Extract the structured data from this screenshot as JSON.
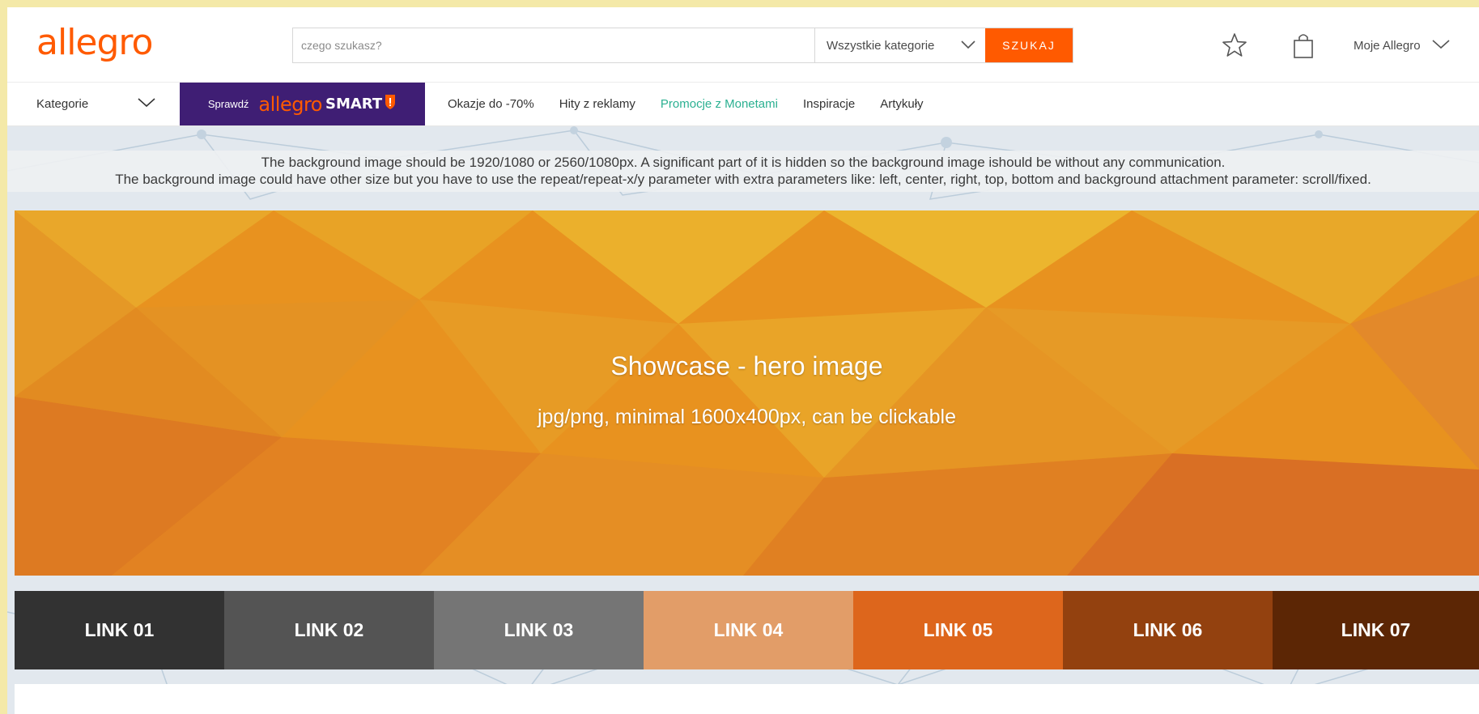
{
  "header": {
    "logo_text": "allegro",
    "search": {
      "placeholder": "czego szukasz?",
      "category_label": "Wszystkie kategorie",
      "button_label": "SZUKAJ"
    },
    "account_label": "Moje Allegro"
  },
  "nav": {
    "categories_label": "Kategorie",
    "smart_prefix": "Sprawdź",
    "smart_logo": "allegro",
    "smart_word": "SMART",
    "links": [
      {
        "label": "Okazje do -70%"
      },
      {
        "label": "Hity z reklamy"
      },
      {
        "label": "Promocje z Monetami"
      },
      {
        "label": "Inspiracje"
      },
      {
        "label": "Artykuły"
      }
    ]
  },
  "notice": {
    "line1": "The background image should be 1920/1080 or 2560/1080px. A significant part of it is hidden so the background image ishould be without any communication.",
    "line2": "The background image could have other size but you have to use the repeat/repeat-x/y parameter with extra parameters like: left, center, right, top, bottom and background attachment parameter: scroll/fixed."
  },
  "hero": {
    "title": "Showcase - hero image",
    "subtitle": "jpg/png, minimal 1600x400px, can be clickable"
  },
  "link_tiles": [
    {
      "label": "LINK 01",
      "color": "#323232"
    },
    {
      "label": "LINK 02",
      "color": "#545454"
    },
    {
      "label": "LINK 03",
      "color": "#757575"
    },
    {
      "label": "LINK 04",
      "color": "#e29d68"
    },
    {
      "label": "LINK 05",
      "color": "#dd661c"
    },
    {
      "label": "LINK 06",
      "color": "#93410f"
    },
    {
      "label": "LINK 07",
      "color": "#5c2605"
    }
  ],
  "colors": {
    "brand_orange": "#ff5a00",
    "smart_purple": "#3f1e74",
    "accent_green": "#2bb091",
    "page_frame": "#f4e9a8"
  },
  "icons": {
    "favorites": "star-icon",
    "cart": "shopping-bag-icon",
    "dropdown": "chevron-down-icon",
    "smart_badge": "smart-badge-icon"
  }
}
